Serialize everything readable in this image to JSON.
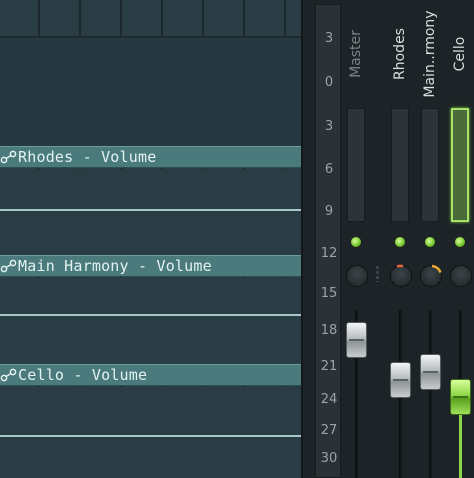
{
  "playlist": {
    "clips": [
      {
        "title": "Rhodes - Volume",
        "icon": "automation-clip-icon"
      },
      {
        "title": "Main Harmony - Volume",
        "icon": "automation-clip-icon"
      },
      {
        "title": "Cello - Volume",
        "icon": "automation-clip-icon"
      }
    ]
  },
  "mixer": {
    "db_scale": [
      "3",
      "0",
      "3",
      "6",
      "9",
      "12",
      "15",
      "18",
      "21",
      "24",
      "27",
      "30"
    ],
    "channels": [
      {
        "name": "Master",
        "selected": false,
        "volume_level": 0.8
      },
      {
        "name": "Rhodes",
        "selected": false,
        "volume_level": 0.7
      },
      {
        "name": "Main..rmony",
        "selected": false,
        "volume_level": 0.74
      },
      {
        "name": "Cello",
        "selected": true,
        "volume_level": 0.6
      }
    ],
    "colors": {
      "led": "#7ecb3a",
      "selected": "#a6e06a",
      "knob_arc_rhodes": "#e8643a",
      "knob_arc_main": "#f0a630"
    }
  }
}
